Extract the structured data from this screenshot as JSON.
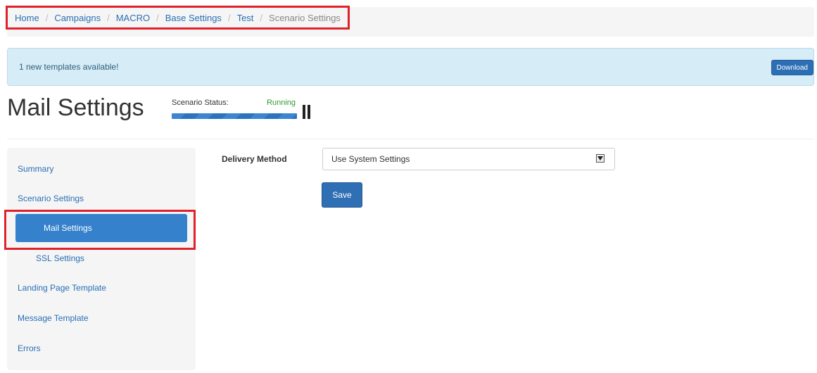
{
  "breadcrumb": {
    "items": [
      "Home",
      "Campaigns",
      "MACRO",
      "Base Settings",
      "Test",
      "Scenario Settings"
    ],
    "separator": "/"
  },
  "alert": {
    "text": "1 new templates available!",
    "button": "Download"
  },
  "page": {
    "title": "Mail Settings"
  },
  "status": {
    "label": "Scenario Status:",
    "value": "Running",
    "progress": 1.0,
    "action_icon": "pause-icon"
  },
  "sidebar": {
    "items": [
      {
        "label": "Summary"
      },
      {
        "label": "Scenario Settings"
      },
      {
        "label": "Mail Settings",
        "active": true
      },
      {
        "label": "SSL Settings"
      },
      {
        "label": "Landing Page Template"
      },
      {
        "label": "Message Template"
      },
      {
        "label": "Errors"
      }
    ]
  },
  "form": {
    "delivery_label": "Delivery Method",
    "delivery_value": "Use System Settings",
    "save_label": "Save"
  },
  "colors": {
    "link": "#2a6fb5",
    "highlight_box": "#e0202a",
    "primary_button": "#2f6fb3",
    "status_running": "#2e9a2e",
    "alert_background": "#d6ecf7"
  }
}
